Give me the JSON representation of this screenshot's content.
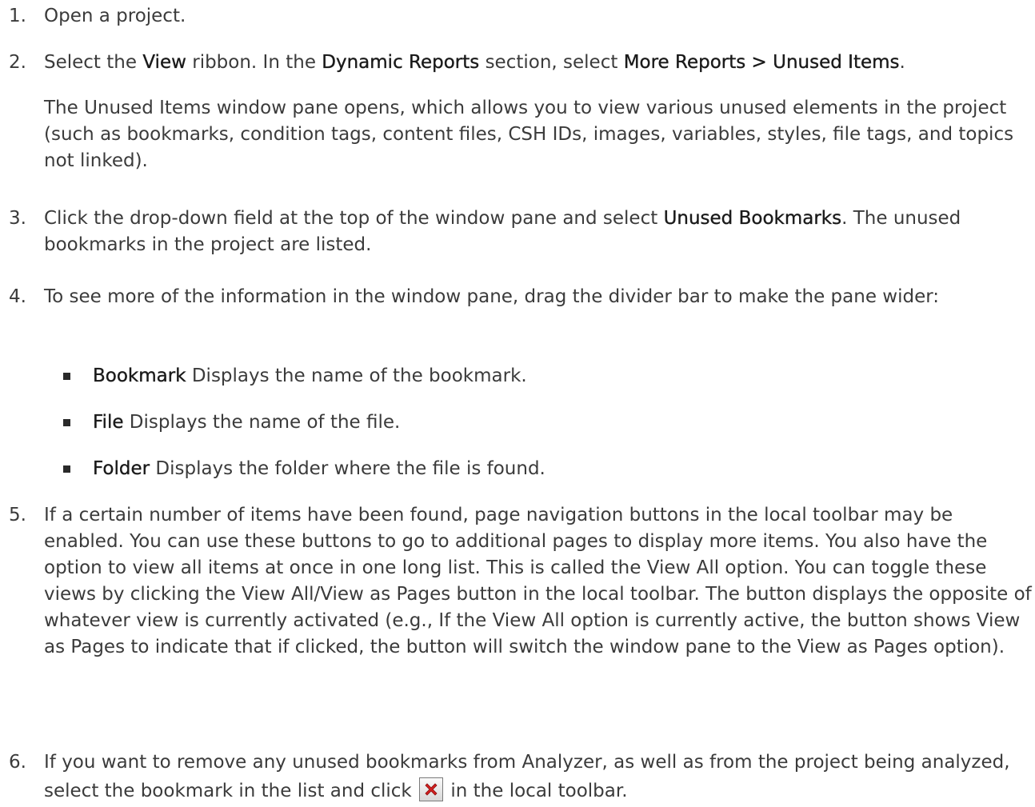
{
  "steps": [
    {
      "num": "1.",
      "text": "Open a project."
    },
    {
      "num": "2.",
      "t1": "Select the ",
      "b1": "View",
      "t2": " ribbon. In the ",
      "b2": "Dynamic Reports",
      "t3": " section, select ",
      "b3": "More Reports > Unused Items",
      "t4": ".",
      "para": "The Unused Items window pane opens, which allows you to view various unused elements in the project (such as bookmarks, condition tags, content files, CSH IDs, images, variables, styles, file tags, and topics not linked)."
    },
    {
      "num": "3.",
      "t1": "Click the drop-down field at the top of the window pane and select ",
      "b1": "Unused Bookmarks",
      "t2": ". The unused bookmarks in the project are listed."
    },
    {
      "num": "4.",
      "text": "To see more of the information in the window pane, drag the divider bar to make the pane wider:",
      "bullets": [
        {
          "term": "Bookmark",
          "desc": " Displays the name of the bookmark."
        },
        {
          "term": "File",
          "desc": " Displays the name of the file."
        },
        {
          "term": "Folder",
          "desc": " Displays the folder where the file is found."
        }
      ]
    },
    {
      "num": "5.",
      "text": "If a certain number of items have been found, page navigation buttons in the local toolbar may be enabled. You can use these buttons to go to additional pages to display more items. You also have the option to view all items at once in one long list. This is called the View All option. You can toggle these views by clicking the View All/View as Pages button in the local toolbar. The button displays the opposite of whatever view is currently activated (e.g., If the View All option is currently active, the button shows View as Pages to indicate that if clicked, the button will switch the window pane to the View as Pages option)."
    },
    {
      "num": "6.",
      "t1": "If you want to remove any unused bookmarks from Analyzer, as well as from the project being analyzed, select the bookmark in the list and click ",
      "icon": "delete-x-icon",
      "t2": " in the local toolbar."
    }
  ],
  "colors": {
    "text": "#3b3b3b",
    "emphasis": "#1a1a1a",
    "delete_icon": "#d42020"
  }
}
